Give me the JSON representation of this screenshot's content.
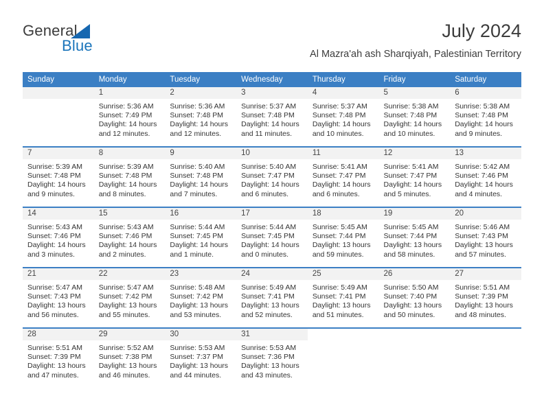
{
  "logo": {
    "word1": "General",
    "word2": "Blue",
    "triangle_color": "#1667b0",
    "blue_color": "#1b75bb"
  },
  "header": {
    "title": "July 2024",
    "subtitle": "Al Mazra'ah ash Sharqiyah, Palestinian Territory"
  },
  "theme": {
    "header_bg": "#3b7fc4",
    "header_text": "#ffffff",
    "daynum_bg": "#f2f2f2",
    "body_text": "#333333"
  },
  "weekdays": [
    "Sunday",
    "Monday",
    "Tuesday",
    "Wednesday",
    "Thursday",
    "Friday",
    "Saturday"
  ],
  "weeks": [
    [
      {
        "day": "",
        "lines": []
      },
      {
        "day": "1",
        "lines": [
          "Sunrise: 5:36 AM",
          "Sunset: 7:49 PM",
          "Daylight: 14 hours",
          "and 12 minutes."
        ]
      },
      {
        "day": "2",
        "lines": [
          "Sunrise: 5:36 AM",
          "Sunset: 7:48 PM",
          "Daylight: 14 hours",
          "and 12 minutes."
        ]
      },
      {
        "day": "3",
        "lines": [
          "Sunrise: 5:37 AM",
          "Sunset: 7:48 PM",
          "Daylight: 14 hours",
          "and 11 minutes."
        ]
      },
      {
        "day": "4",
        "lines": [
          "Sunrise: 5:37 AM",
          "Sunset: 7:48 PM",
          "Daylight: 14 hours",
          "and 10 minutes."
        ]
      },
      {
        "day": "5",
        "lines": [
          "Sunrise: 5:38 AM",
          "Sunset: 7:48 PM",
          "Daylight: 14 hours",
          "and 10 minutes."
        ]
      },
      {
        "day": "6",
        "lines": [
          "Sunrise: 5:38 AM",
          "Sunset: 7:48 PM",
          "Daylight: 14 hours",
          "and 9 minutes."
        ]
      }
    ],
    [
      {
        "day": "7",
        "lines": [
          "Sunrise: 5:39 AM",
          "Sunset: 7:48 PM",
          "Daylight: 14 hours",
          "and 9 minutes."
        ]
      },
      {
        "day": "8",
        "lines": [
          "Sunrise: 5:39 AM",
          "Sunset: 7:48 PM",
          "Daylight: 14 hours",
          "and 8 minutes."
        ]
      },
      {
        "day": "9",
        "lines": [
          "Sunrise: 5:40 AM",
          "Sunset: 7:48 PM",
          "Daylight: 14 hours",
          "and 7 minutes."
        ]
      },
      {
        "day": "10",
        "lines": [
          "Sunrise: 5:40 AM",
          "Sunset: 7:47 PM",
          "Daylight: 14 hours",
          "and 6 minutes."
        ]
      },
      {
        "day": "11",
        "lines": [
          "Sunrise: 5:41 AM",
          "Sunset: 7:47 PM",
          "Daylight: 14 hours",
          "and 6 minutes."
        ]
      },
      {
        "day": "12",
        "lines": [
          "Sunrise: 5:41 AM",
          "Sunset: 7:47 PM",
          "Daylight: 14 hours",
          "and 5 minutes."
        ]
      },
      {
        "day": "13",
        "lines": [
          "Sunrise: 5:42 AM",
          "Sunset: 7:46 PM",
          "Daylight: 14 hours",
          "and 4 minutes."
        ]
      }
    ],
    [
      {
        "day": "14",
        "lines": [
          "Sunrise: 5:43 AM",
          "Sunset: 7:46 PM",
          "Daylight: 14 hours",
          "and 3 minutes."
        ]
      },
      {
        "day": "15",
        "lines": [
          "Sunrise: 5:43 AM",
          "Sunset: 7:46 PM",
          "Daylight: 14 hours",
          "and 2 minutes."
        ]
      },
      {
        "day": "16",
        "lines": [
          "Sunrise: 5:44 AM",
          "Sunset: 7:45 PM",
          "Daylight: 14 hours",
          "and 1 minute."
        ]
      },
      {
        "day": "17",
        "lines": [
          "Sunrise: 5:44 AM",
          "Sunset: 7:45 PM",
          "Daylight: 14 hours",
          "and 0 minutes."
        ]
      },
      {
        "day": "18",
        "lines": [
          "Sunrise: 5:45 AM",
          "Sunset: 7:44 PM",
          "Daylight: 13 hours",
          "and 59 minutes."
        ]
      },
      {
        "day": "19",
        "lines": [
          "Sunrise: 5:45 AM",
          "Sunset: 7:44 PM",
          "Daylight: 13 hours",
          "and 58 minutes."
        ]
      },
      {
        "day": "20",
        "lines": [
          "Sunrise: 5:46 AM",
          "Sunset: 7:43 PM",
          "Daylight: 13 hours",
          "and 57 minutes."
        ]
      }
    ],
    [
      {
        "day": "21",
        "lines": [
          "Sunrise: 5:47 AM",
          "Sunset: 7:43 PM",
          "Daylight: 13 hours",
          "and 56 minutes."
        ]
      },
      {
        "day": "22",
        "lines": [
          "Sunrise: 5:47 AM",
          "Sunset: 7:42 PM",
          "Daylight: 13 hours",
          "and 55 minutes."
        ]
      },
      {
        "day": "23",
        "lines": [
          "Sunrise: 5:48 AM",
          "Sunset: 7:42 PM",
          "Daylight: 13 hours",
          "and 53 minutes."
        ]
      },
      {
        "day": "24",
        "lines": [
          "Sunrise: 5:49 AM",
          "Sunset: 7:41 PM",
          "Daylight: 13 hours",
          "and 52 minutes."
        ]
      },
      {
        "day": "25",
        "lines": [
          "Sunrise: 5:49 AM",
          "Sunset: 7:41 PM",
          "Daylight: 13 hours",
          "and 51 minutes."
        ]
      },
      {
        "day": "26",
        "lines": [
          "Sunrise: 5:50 AM",
          "Sunset: 7:40 PM",
          "Daylight: 13 hours",
          "and 50 minutes."
        ]
      },
      {
        "day": "27",
        "lines": [
          "Sunrise: 5:51 AM",
          "Sunset: 7:39 PM",
          "Daylight: 13 hours",
          "and 48 minutes."
        ]
      }
    ],
    [
      {
        "day": "28",
        "lines": [
          "Sunrise: 5:51 AM",
          "Sunset: 7:39 PM",
          "Daylight: 13 hours",
          "and 47 minutes."
        ]
      },
      {
        "day": "29",
        "lines": [
          "Sunrise: 5:52 AM",
          "Sunset: 7:38 PM",
          "Daylight: 13 hours",
          "and 46 minutes."
        ]
      },
      {
        "day": "30",
        "lines": [
          "Sunrise: 5:53 AM",
          "Sunset: 7:37 PM",
          "Daylight: 13 hours",
          "and 44 minutes."
        ]
      },
      {
        "day": "31",
        "lines": [
          "Sunrise: 5:53 AM",
          "Sunset: 7:36 PM",
          "Daylight: 13 hours",
          "and 43 minutes."
        ]
      },
      {
        "day": "",
        "lines": [],
        "blank": true
      },
      {
        "day": "",
        "lines": [],
        "blank": true
      },
      {
        "day": "",
        "lines": [],
        "blank": true
      }
    ]
  ]
}
